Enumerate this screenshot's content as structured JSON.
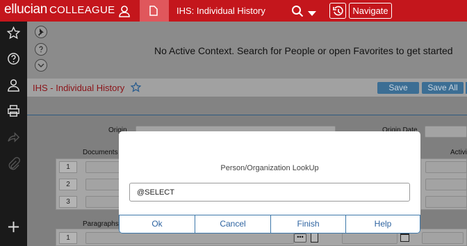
{
  "header": {
    "brand_primary": "ellucian",
    "brand_secondary": "COLLEAGUE",
    "form_tab_title": "IHS: Individual History",
    "navigate_label": "Navigate",
    "bar_color": "#c4161c"
  },
  "rail": {
    "icons": [
      "star-icon",
      "help-icon",
      "user-icon",
      "printer-icon",
      "share-icon",
      "paperclip-icon",
      "plus-icon"
    ]
  },
  "context": {
    "message": "No Active Context. Search for People or open Favorites to get started"
  },
  "form": {
    "title": "IHS - Individual History",
    "save_label": "Save",
    "save_all_label": "Save All",
    "origin_label": "Origin",
    "origin_date_label": "Origin Date",
    "documents_label": "Documents",
    "activity_label": "Activi",
    "paragraphs_label": "Paragraphs",
    "document_rows": [
      "1",
      "2",
      "3"
    ],
    "paragraph_rows": [
      "1"
    ]
  },
  "dialog": {
    "title": "Person/Organization LookUp",
    "input_value": "@SELECT",
    "buttons": {
      "ok": "Ok",
      "cancel": "Cancel",
      "finish": "Finish",
      "help": "Help"
    }
  }
}
